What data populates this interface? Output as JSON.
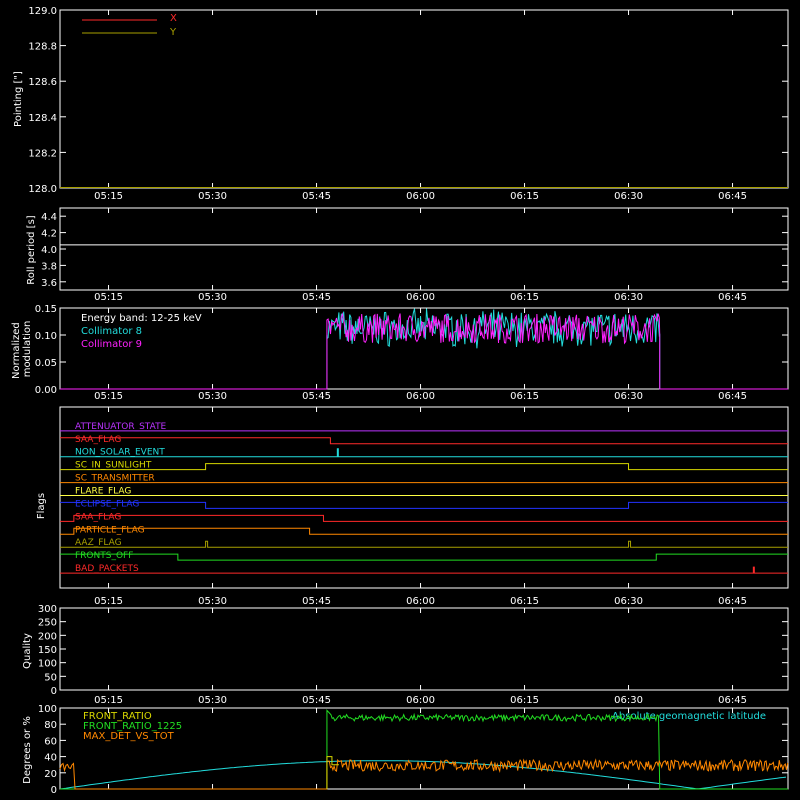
{
  "time_ticks": [
    "05:15",
    "05:30",
    "05:45",
    "06:00",
    "06:15",
    "06:30",
    "06:45"
  ],
  "colors": {
    "background": "#000000",
    "axes": "#ffffff",
    "red": "#ff2a2a",
    "yellow": "#d8d800",
    "olive": "#a8a000",
    "cyan": "#22dddd",
    "magenta": "#ff22ff",
    "green": "#22dd22",
    "orange": "#ff8800",
    "blue": "#2233ff",
    "purple": "#bb33ff"
  },
  "chart_data": [
    {
      "type": "line",
      "ylabel": "Pointing [\"]",
      "ylim": [
        128.0,
        129.0
      ],
      "yticks": [
        "128.0",
        "128.2",
        "128.4",
        "128.6",
        "128.8",
        "129.0"
      ],
      "series": [
        {
          "name": "X",
          "color": "#ff2a2a"
        },
        {
          "name": "Y",
          "color": "#a8a000"
        }
      ]
    },
    {
      "type": "line",
      "ylabel": "Roll period [s]",
      "ylim": [
        3.5,
        4.5
      ],
      "yticks": [
        "3.6",
        "3.8",
        "4.0",
        "4.2",
        "4.4"
      ],
      "series": [
        {
          "value": 4.05,
          "color": "#ffffff"
        }
      ]
    },
    {
      "type": "line",
      "ylabel": "Normalized modulation",
      "ylim": [
        0.0,
        0.15
      ],
      "yticks": [
        "0.00",
        "0.05",
        "0.10",
        "0.15"
      ],
      "annotation": "Energy band: 12-25 keV",
      "active_interval": [
        "05:46.5",
        "06:34.5"
      ],
      "series": [
        {
          "name": "Collimator 8",
          "color": "#22dddd",
          "typical": 0.1
        },
        {
          "name": "Collimator 9",
          "color": "#ff22ff",
          "typical": 0.1
        }
      ]
    },
    {
      "type": "line",
      "ylabel": "Flags",
      "flags": [
        {
          "name": "ATTENUATOR_STATE",
          "color": "#bb33ff"
        },
        {
          "name": "SAA_FLAG",
          "color": "#ff2a2a"
        },
        {
          "name": "NON_SOLAR_EVENT",
          "color": "#22dddd"
        },
        {
          "name": "SC_IN_SUNLIGHT",
          "color": "#d8d800"
        },
        {
          "name": "SC_TRANSMITTER",
          "color": "#ff8800"
        },
        {
          "name": "FLARE_FLAG",
          "color": "#ffff44"
        },
        {
          "name": "ECLIPSE_FLAG",
          "color": "#2233ff"
        },
        {
          "name": "SAA_FLAG",
          "color": "#ff2a2a"
        },
        {
          "name": "PARTICLE_FLAG",
          "color": "#ff8800"
        },
        {
          "name": "AAZ_FLAG",
          "color": "#a8a000"
        },
        {
          "name": "FRONTS_OFF",
          "color": "#22dd22"
        },
        {
          "name": "BAD_PACKETS",
          "color": "#ff2a2a"
        }
      ]
    },
    {
      "type": "line",
      "ylabel": "Quality",
      "ylim": [
        0,
        300
      ],
      "yticks": [
        "0",
        "50",
        "100",
        "150",
        "200",
        "250",
        "300"
      ]
    },
    {
      "type": "line",
      "ylabel": "Degrees or %",
      "ylim": [
        0,
        100
      ],
      "yticks": [
        "0",
        "20",
        "40",
        "60",
        "80",
        "100"
      ],
      "series": [
        {
          "name": "FRONT_RATIO",
          "color": "#d8d800"
        },
        {
          "name": "FRONT_RATIO_1225",
          "color": "#22dd22",
          "typical": 88
        },
        {
          "name": "MAX_DET_VS_TOT",
          "color": "#ff8800",
          "typical": 28
        },
        {
          "name": "Absolute geomagnetic latitude",
          "color": "#22dddd",
          "max": 35
        }
      ]
    }
  ]
}
